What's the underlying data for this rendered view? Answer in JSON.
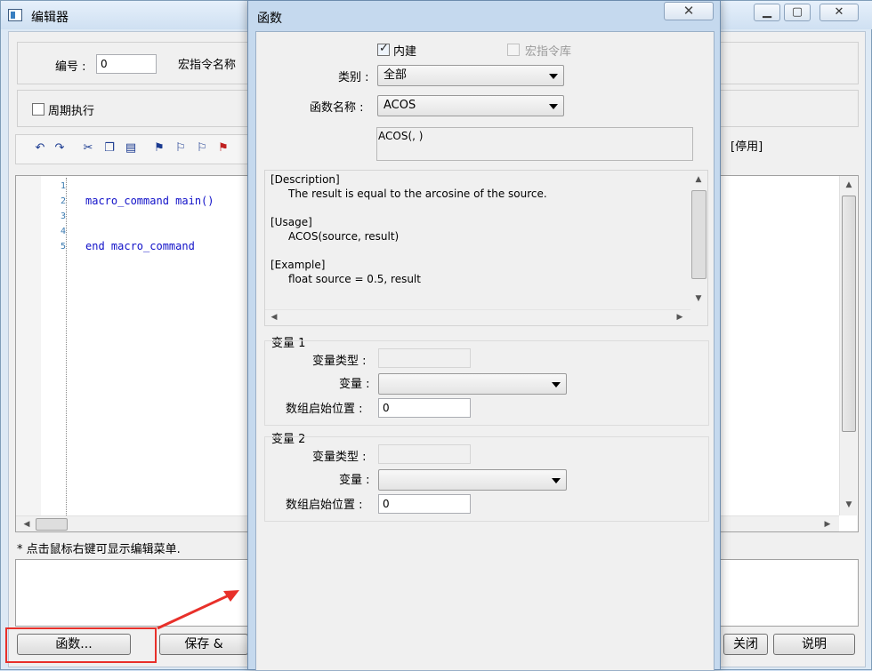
{
  "editor": {
    "title": "编辑器",
    "number_label": "编号 :",
    "number_value": "0",
    "macro_name_label": "宏指令名称",
    "periodic_label": "周期执行",
    "status_label": "[停用]",
    "code_lines": [
      {
        "num": "1",
        "text": ""
      },
      {
        "num": "2",
        "text": "macro_command main()"
      },
      {
        "num": "3",
        "text": ""
      },
      {
        "num": "4",
        "text": ""
      },
      {
        "num": "5",
        "text": "end macro_command"
      }
    ],
    "hint": "* 点击鼠标右键可显示编辑菜单.",
    "buttons": {
      "function": "函数...",
      "save": "保存 &",
      "close": "关闭",
      "help": "说明"
    }
  },
  "dialog": {
    "title": "函数",
    "builtin_label": "内建",
    "macro_lib_label": "宏指令库",
    "category_label": "类别 :",
    "category_value": "全部",
    "function_name_label": "函数名称 :",
    "function_name_value": "ACOS",
    "prototype": "ACOS(, )",
    "description_lines": [
      {
        "text": "[Description]",
        "indent": false
      },
      {
        "text": "The result is equal to the arcosine of the source.",
        "indent": true
      },
      {
        "text": "",
        "indent": false
      },
      {
        "text": "[Usage]",
        "indent": false
      },
      {
        "text": "ACOS(source, result)",
        "indent": true
      },
      {
        "text": "",
        "indent": false
      },
      {
        "text": "[Example]",
        "indent": false
      },
      {
        "text": "float source = 0.5, result",
        "indent": true
      }
    ],
    "var1": {
      "title": "变量 1",
      "type_label": "变量类型 :",
      "type_value": "",
      "var_label": "变量 :",
      "var_value": "",
      "array_start_label": "数组启始位置 :",
      "array_start_value": "0"
    },
    "var2": {
      "title": "变量 2",
      "type_label": "变量类型 :",
      "type_value": "",
      "var_label": "变量 :",
      "var_value": "",
      "array_start_label": "数组启始位置 :",
      "array_start_value": "0"
    }
  },
  "colors": {
    "keyword": "#1010c8",
    "highlight": "#e8302a"
  }
}
